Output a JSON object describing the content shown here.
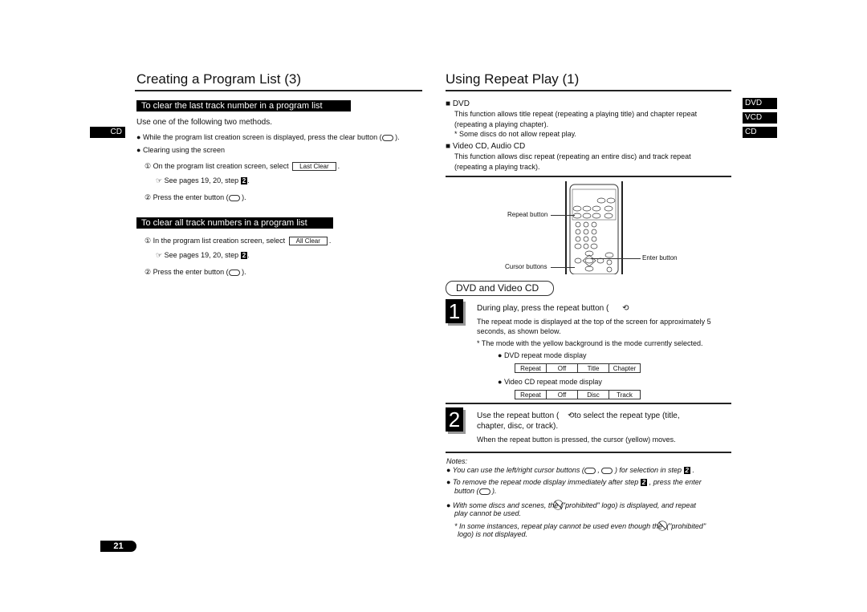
{
  "left": {
    "title": "Creating a Program List (3)",
    "side_tab": "CD",
    "section1": {
      "heading": "To clear the last track number in a program list",
      "intro": "Use one of the following two methods.",
      "bullet1": "While the program list creation screen is displayed, press the clear button (",
      "bullet1_end": ").",
      "bullet2": "Clearing using the screen",
      "step1": "On the program list creation screen, select",
      "step1_button": "Last Clear",
      "see": "See pages 19, 20, step",
      "step_ref": "2",
      "step2": "Press the enter button (",
      "step2_end": ")."
    },
    "section2": {
      "heading": "To clear all track numbers in a program list",
      "step1": "In the program list creation screen, select",
      "step1_button": "All Clear",
      "see": "See pages 19, 20, step",
      "step_ref": "2",
      "step2": "Press the enter button (",
      "step2_end": ")."
    },
    "page_number": "21"
  },
  "right": {
    "title": "Using Repeat Play (1)",
    "side_tabs": [
      "DVD",
      "VCD",
      "CD"
    ],
    "dvd": {
      "heading": "DVD",
      "line1": "This function allows title repeat (repeating a playing title) and chapter repeat",
      "line2": "(repeating a playing chapter).",
      "note": "* Some discs do not allow repeat play."
    },
    "vcd": {
      "heading": "Video CD, Audio CD",
      "line1": "This function allows disc repeat (repeating an entire disc) and track repeat",
      "line2": "(repeating a playing track)."
    },
    "remote_labels": {
      "repeat": "Repeat button",
      "enter": "Enter button",
      "cursor": "Cursor buttons"
    },
    "mode_heading": "DVD and Video CD",
    "step1": {
      "number": "1",
      "title": "During play, press the repeat button (",
      "line1": "The repeat mode is displayed at the top of the screen for approximately 5",
      "line2": "seconds, as shown below.",
      "note": "* The mode with the yellow background is the mode currently selected.",
      "dvd_label": "DVD repeat mode display",
      "dvd_cells": [
        "Repeat",
        "Off",
        "Title",
        "Chapter"
      ],
      "vcd_label": "Video CD repeat mode display",
      "vcd_cells": [
        "Repeat",
        "Off",
        "Disc",
        "Track"
      ]
    },
    "step2": {
      "number": "2",
      "line1a": "Use the repeat button (",
      "line1b": "to select the repeat type (title,",
      "line2": "chapter, disc, or track).",
      "desc": "When the repeat button is pressed, the cursor (yellow) moves."
    },
    "notes": {
      "heading": "Notes:",
      "n1a": "You can use the left/right cursor buttons (",
      "n1b": ",",
      "n1c": ") for selection in step",
      "n1ref": "2",
      "n2a": "To remove the repeat mode display immediately after step",
      "n2ref": "2",
      "n2b": ", press the enter",
      "n2c": "button (",
      "n2d": ").",
      "n3a": "With some discs and scenes, the",
      "n3b": "(\"prohibited\" logo) is displayed, and repeat",
      "n3c": "play cannot be used.",
      "n4a": "* In some instances, repeat play cannot be used even though the",
      "n4b": "(\"prohibited\"",
      "n4c": "logo) is not displayed."
    }
  }
}
